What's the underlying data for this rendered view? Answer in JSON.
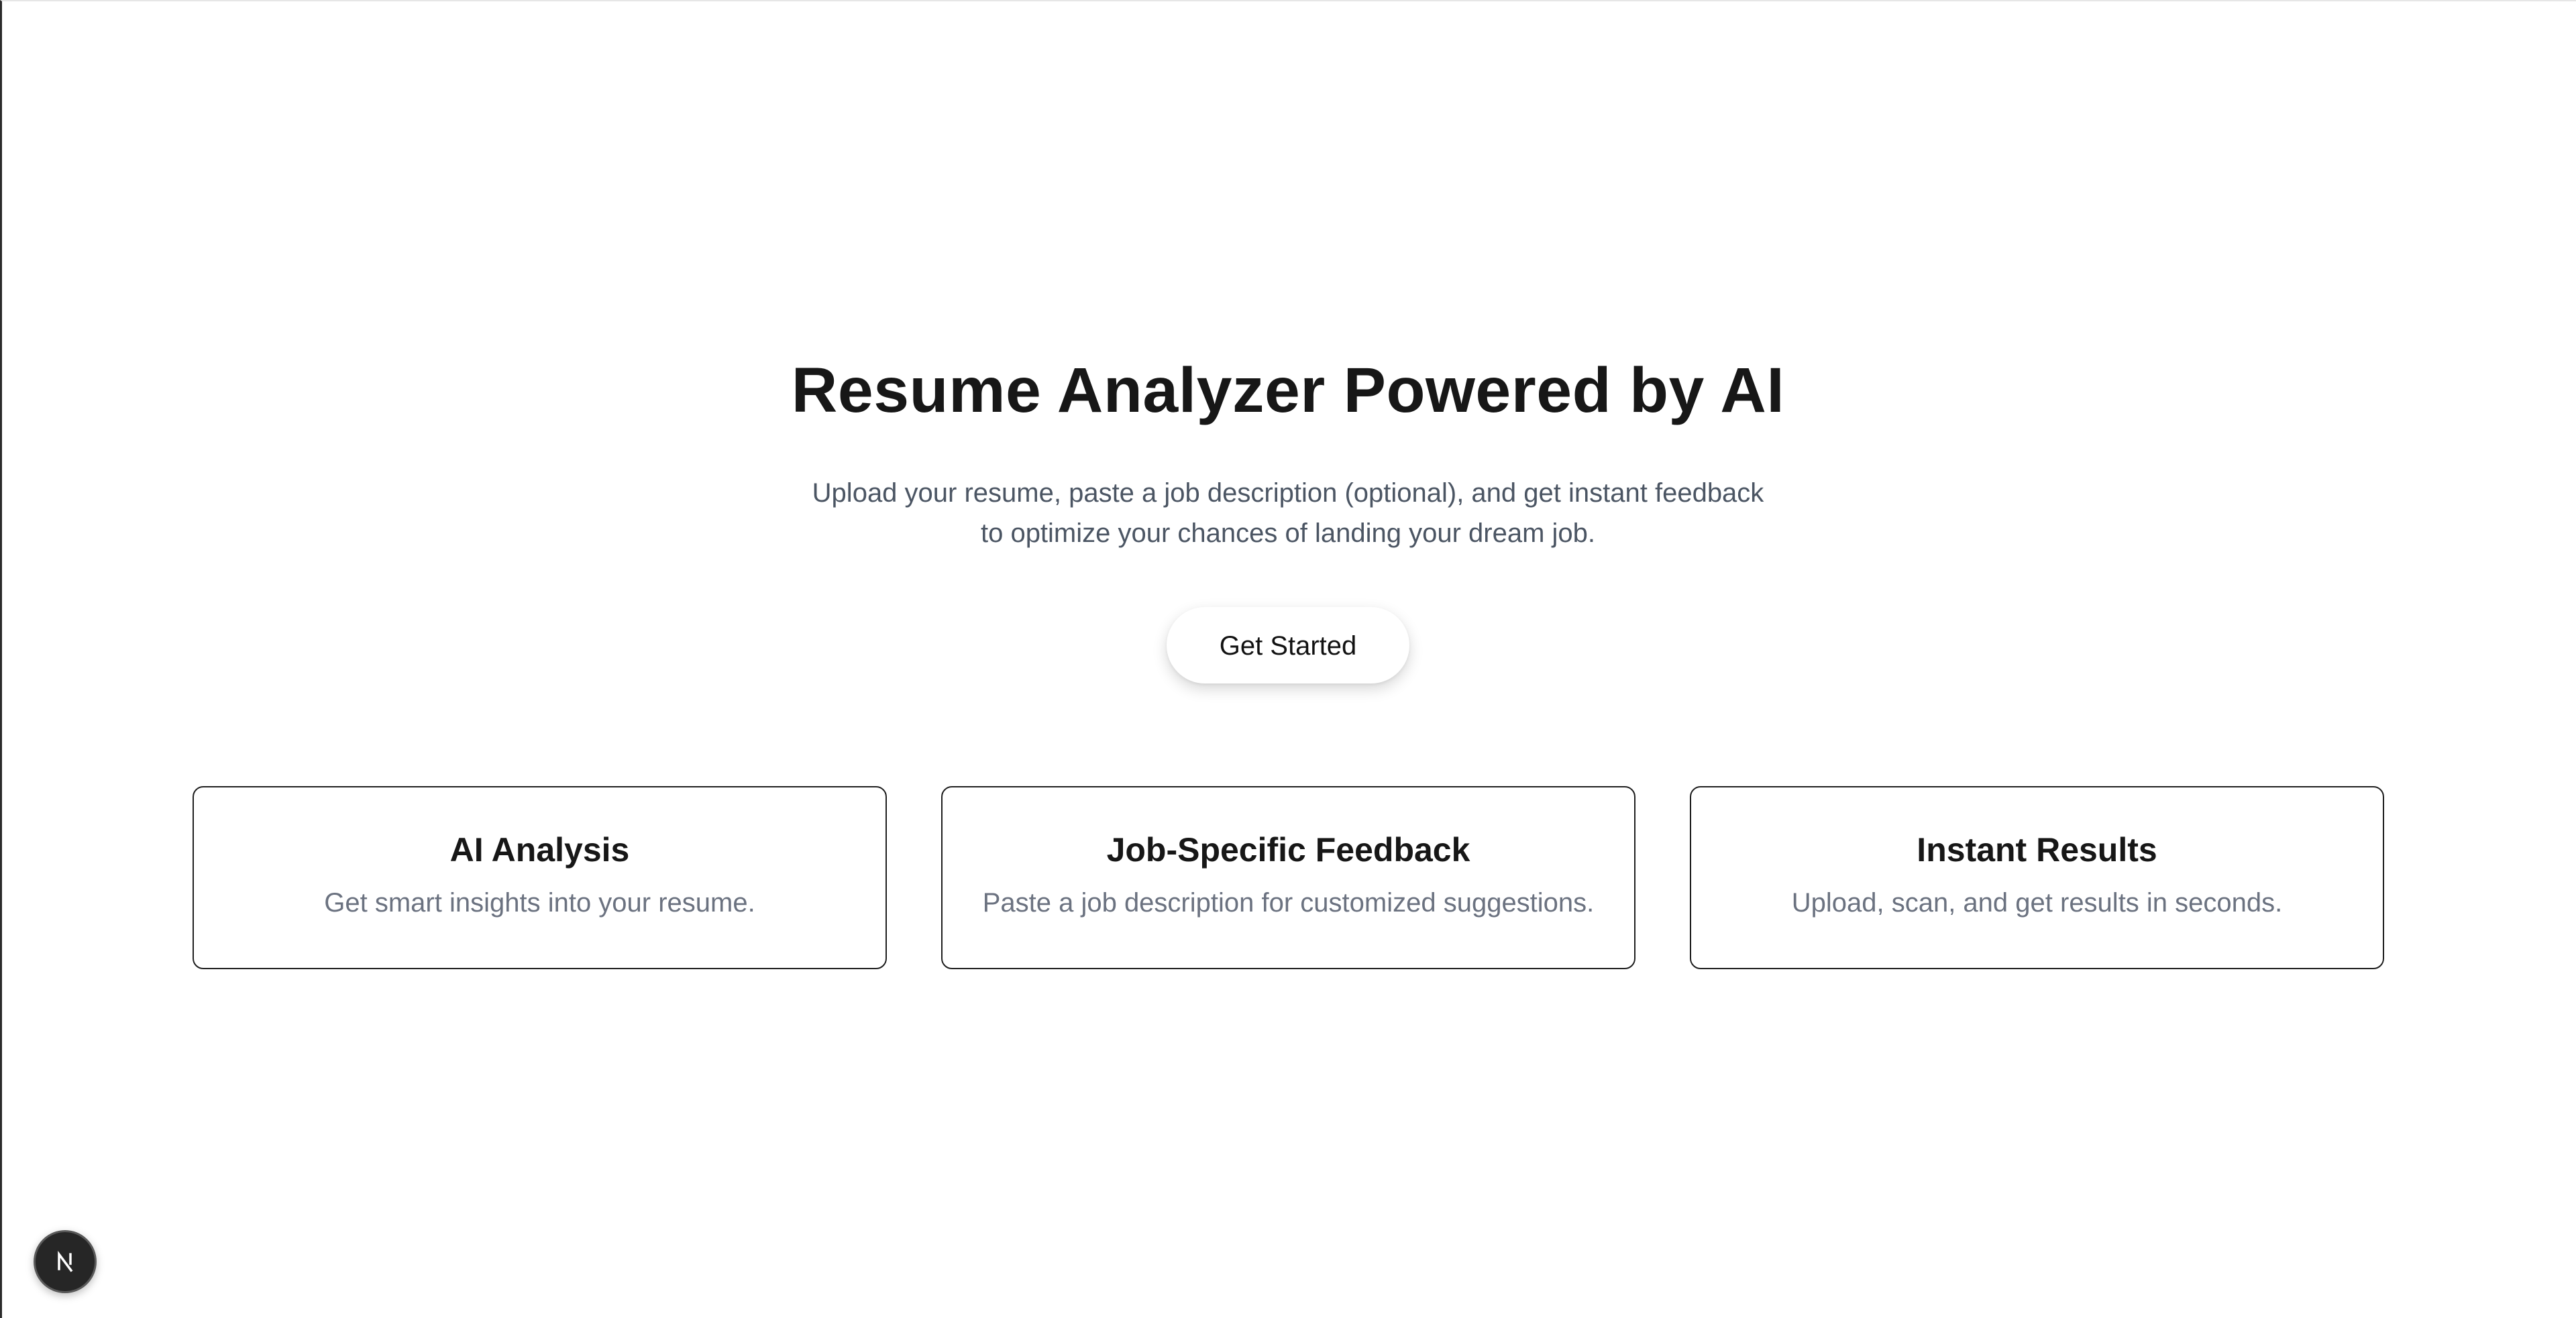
{
  "hero": {
    "title": "Resume Analyzer Powered by AI",
    "subtitle": "Upload your resume, paste a job description (optional), and get instant feedback to optimize your chances of landing your dream job.",
    "cta_label": "Get Started"
  },
  "features": [
    {
      "title": "AI Analysis",
      "description": "Get smart insights into your resume."
    },
    {
      "title": "Job-Specific Feedback",
      "description": "Paste a job description for customized suggestions."
    },
    {
      "title": "Instant Results",
      "description": "Upload, scan, and get results in seconds."
    }
  ],
  "dev_badge": {
    "icon": "nextjs-logo-icon"
  },
  "colors": {
    "text_primary": "#171717",
    "text_secondary": "#4b5563",
    "text_muted": "#6b7280",
    "card_border": "#1f1f1f",
    "badge_bg": "#262626"
  }
}
